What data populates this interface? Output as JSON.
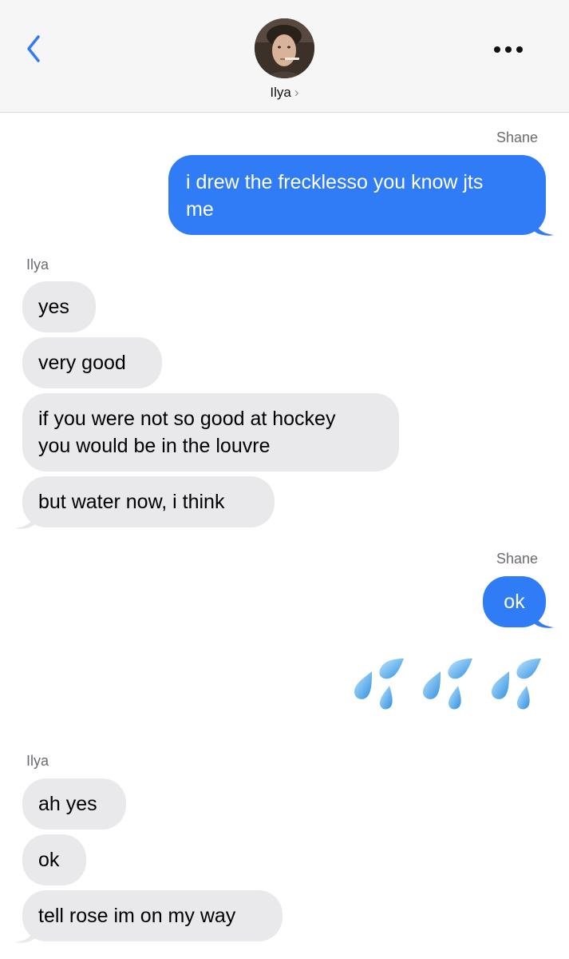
{
  "header": {
    "contact_name": "Ilya",
    "chevron": "›",
    "back_icon": "chevron-left-icon",
    "more_icon": "ellipsis-icon",
    "accent_color": "#2f7cf6"
  },
  "messages": [
    {
      "sender_label": "Shane"
    },
    {
      "text": "i drew the frecklesso you know jts\nme"
    },
    {
      "sender_label": "Ilya"
    },
    {
      "text": "yes"
    },
    {
      "text": "very good"
    },
    {
      "text": "if you were not so good at hockey\nyou would be in the louvre"
    },
    {
      "text": "but water now, i think"
    },
    {
      "sender_label": "Shane"
    },
    {
      "text": "ok"
    },
    {
      "emoji": "sweat-droplets-icon",
      "count": 3
    },
    {
      "sender_label": "Ilya"
    },
    {
      "text": "ah yes"
    },
    {
      "text": "ok"
    },
    {
      "text": "tell rose im on my way"
    }
  ],
  "colors": {
    "incoming_bubble": "#e9e9eb",
    "outgoing_bubble": "#2f7cf6"
  }
}
